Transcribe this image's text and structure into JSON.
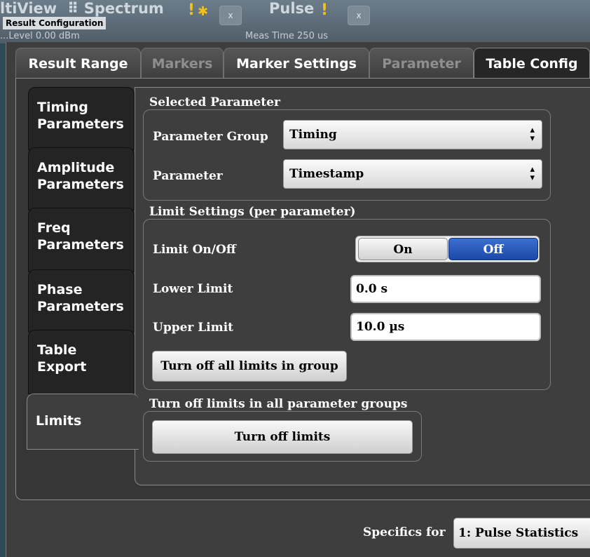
{
  "window": {
    "dialog_title": "Result Configuration",
    "app_tabs": [
      {
        "label": "ltiView"
      },
      {
        "label": "Spectrum"
      },
      {
        "label": "Pulse"
      }
    ],
    "bg_close_label": "x",
    "warning_symbol": "!",
    "status_left": "...Level 0.00 dBm",
    "status_right": "Meas Time  250 us"
  },
  "top_tabs": [
    {
      "label": "Result Range",
      "state": "normal"
    },
    {
      "label": "Markers",
      "state": "disabled"
    },
    {
      "label": "Marker Settings",
      "state": "normal"
    },
    {
      "label": "Parameter",
      "state": "disabled"
    },
    {
      "label": "Table Config",
      "state": "selected"
    }
  ],
  "side_tabs": [
    {
      "line1": "Timing",
      "line2": "Parameters"
    },
    {
      "line1": "Amplitude",
      "line2": "Parameters"
    },
    {
      "line1": "Freq",
      "line2": "Parameters"
    },
    {
      "line1": "Phase",
      "line2": "Parameters"
    },
    {
      "line1": "Table",
      "line2": "Export"
    },
    {
      "line1": "Limits",
      "line2": ""
    }
  ],
  "selected_parameter": {
    "title": "Selected Parameter",
    "group_label": "Parameter Group",
    "group_value": "Timing",
    "param_label": "Parameter",
    "param_value": "Timestamp"
  },
  "limit_settings": {
    "title": "Limit Settings (per parameter)",
    "onoff_label": "Limit On/Off",
    "on_label": "On",
    "off_label": "Off",
    "selected": "Off",
    "lower_label": "Lower Limit",
    "lower_value": "0.0 s",
    "upper_label": "Upper Limit",
    "upper_value": "10.0 µs",
    "turn_off_group_button": "Turn off all limits in group"
  },
  "all_groups": {
    "title": "Turn off limits in all parameter groups",
    "button": "Turn off limits"
  },
  "specifics": {
    "label": "Specifics for",
    "value": "1: Pulse Statistics"
  },
  "colors": {
    "off_selected": "#1b49a8",
    "background": "#3e3e3e",
    "warning": "#f0c020"
  }
}
